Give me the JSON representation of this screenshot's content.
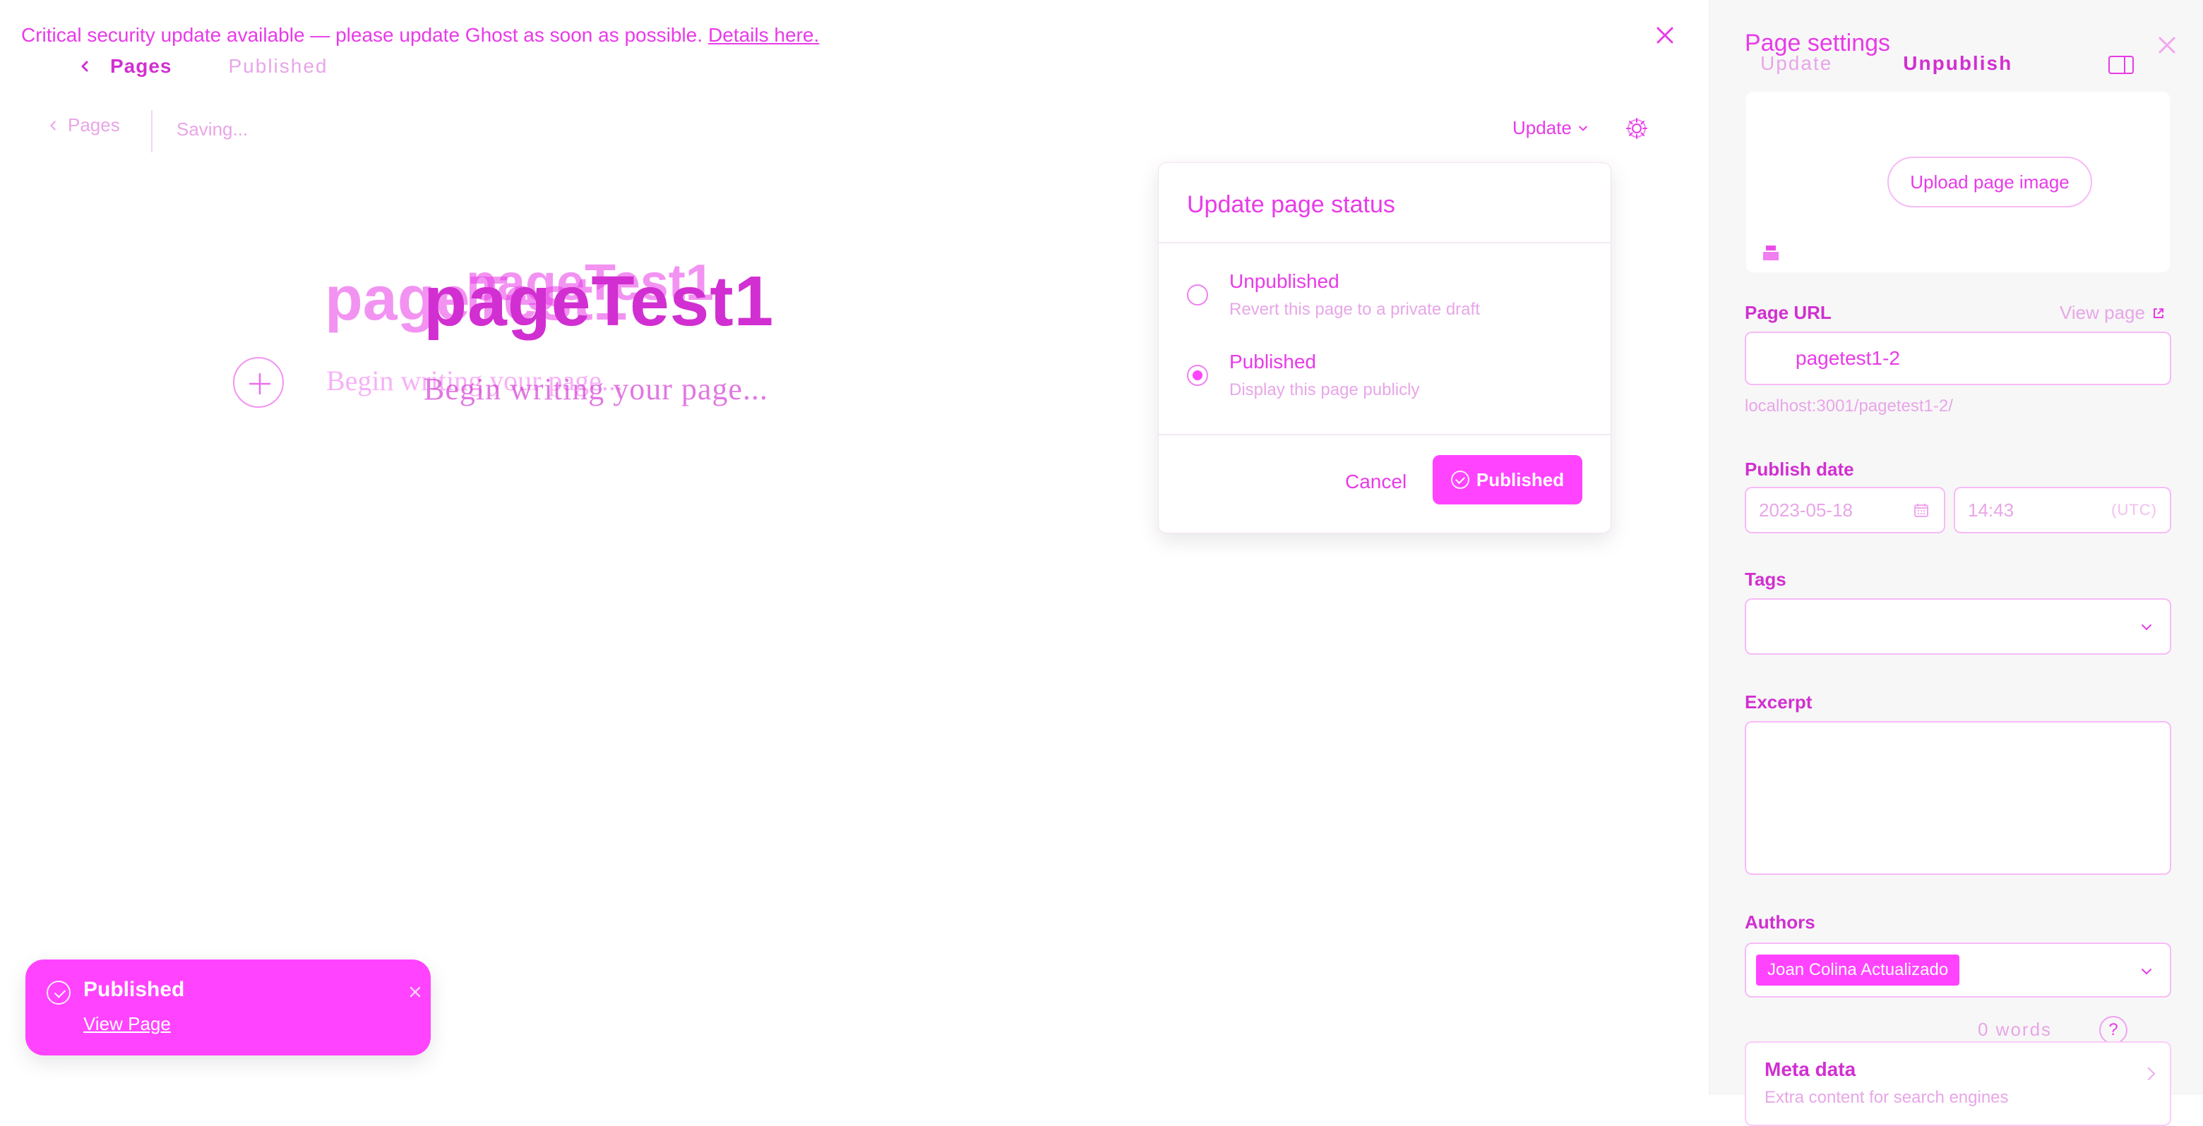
{
  "banner": {
    "message": "Critical security update available — please update Ghost as soon as possible.",
    "details_link": "Details here."
  },
  "subheader": {
    "pages": "Pages",
    "published": "Published"
  },
  "editor": {
    "back_label": "Pages",
    "status": "Saving...",
    "update_label": "Update",
    "title": "pageTest1",
    "placeholder": "Begin writing your page..."
  },
  "popover": {
    "title": "Update page status",
    "options": [
      {
        "label": "Unpublished",
        "description": "Revert this page to a private draft"
      },
      {
        "label": "Published",
        "description": "Display this page publicly"
      }
    ],
    "selected": "Published",
    "cancel": "Cancel",
    "primary": "Published"
  },
  "toast": {
    "title": "Published",
    "link": "View Page"
  },
  "settings": {
    "title": "Page settings",
    "actions": {
      "update": "Update",
      "unpublish": "Unpublish"
    },
    "upload_label": "Upload page image",
    "page_url": {
      "label": "Page URL",
      "view_link": "View page",
      "value": "pagetest1-2",
      "full": "localhost:3001/pagetest1-2/"
    },
    "publish_date": {
      "label": "Publish date",
      "date": "2023-05-18",
      "time": "14:43",
      "timezone": "(UTC)"
    },
    "tags_label": "Tags",
    "excerpt_label": "Excerpt",
    "authors": {
      "label": "Authors",
      "selected": "Joan Colina Actualizado"
    },
    "words": "0 words",
    "help": "?",
    "meta": {
      "title": "Meta data",
      "description": "Extra content for search engines"
    }
  }
}
